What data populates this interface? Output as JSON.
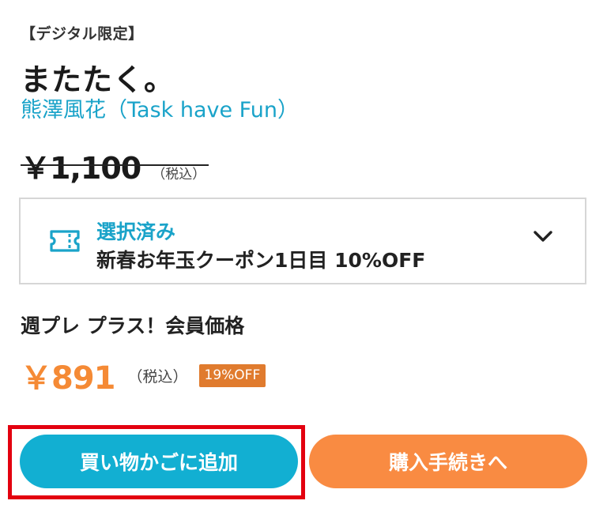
{
  "product": {
    "label": "【デジタル限定】",
    "title": "またたく。",
    "author": "熊澤風花（Task have Fun）",
    "original_price": "￥1,100",
    "original_tax": "（税込）"
  },
  "coupon": {
    "status": "選択済み",
    "name": "新春お年玉クーポン1日目 10%OFF",
    "icon": "ticket-icon",
    "toggle_icon": "chevron-down-icon"
  },
  "member": {
    "label": "週プレ プラス！会員価格",
    "price": "￥891",
    "tax": "（税込）",
    "discount_badge": "19%OFF"
  },
  "actions": {
    "add_to_cart": "買い物かごに追加",
    "checkout": "購入手続きへ"
  },
  "colors": {
    "accent_blue": "#12afd2",
    "accent_orange": "#f98b42",
    "price_orange": "#f58a35",
    "highlight_red": "#e3000f"
  }
}
